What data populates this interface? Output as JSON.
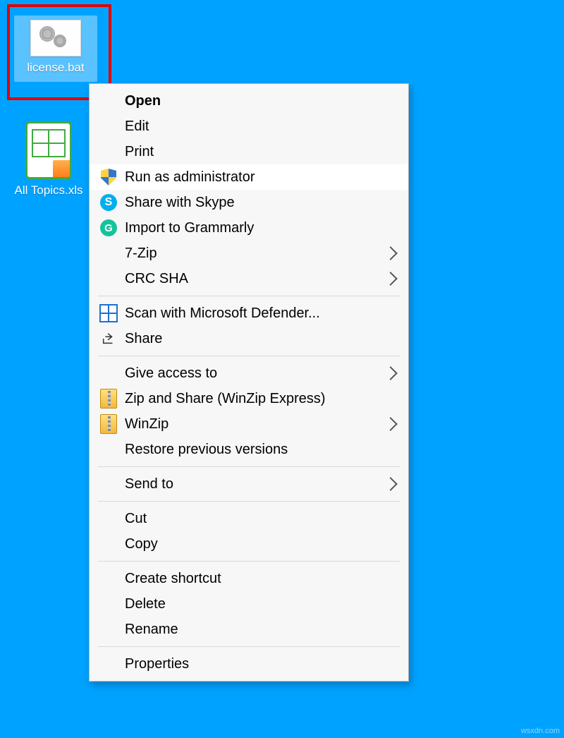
{
  "desktop": {
    "icons": [
      {
        "label": "license.bat",
        "type": "bat",
        "selected": true
      },
      {
        "label": "All Topics.xls",
        "type": "xls",
        "selected": false
      }
    ]
  },
  "context_menu": {
    "highlighted_index": 3,
    "items": [
      {
        "label": "Open",
        "bold": true
      },
      {
        "label": "Edit"
      },
      {
        "label": "Print"
      },
      {
        "label": "Run as administrator",
        "icon": "shield-icon"
      },
      {
        "label": "Share with Skype",
        "icon": "skype-icon"
      },
      {
        "label": "Import to Grammarly",
        "icon": "grammarly-icon"
      },
      {
        "label": "7-Zip",
        "submenu": true
      },
      {
        "label": "CRC SHA",
        "submenu": true
      },
      {
        "sep": true
      },
      {
        "label": "Scan with Microsoft Defender...",
        "icon": "defender-icon"
      },
      {
        "label": "Share",
        "icon": "share-icon"
      },
      {
        "sep": true
      },
      {
        "label": "Give access to",
        "submenu": true
      },
      {
        "label": "Zip and Share (WinZip Express)",
        "icon": "winzip-icon"
      },
      {
        "label": "WinZip",
        "icon": "winzip-icon",
        "submenu": true
      },
      {
        "label": "Restore previous versions"
      },
      {
        "sep": true
      },
      {
        "label": "Send to",
        "submenu": true
      },
      {
        "sep": true
      },
      {
        "label": "Cut"
      },
      {
        "label": "Copy"
      },
      {
        "sep": true
      },
      {
        "label": "Create shortcut"
      },
      {
        "label": "Delete"
      },
      {
        "label": "Rename"
      },
      {
        "sep": true
      },
      {
        "label": "Properties"
      }
    ]
  },
  "annotations": {
    "highlight_desktop_icon": true,
    "highlight_menu_item_index": 3
  },
  "watermark": "wsxdn.com"
}
